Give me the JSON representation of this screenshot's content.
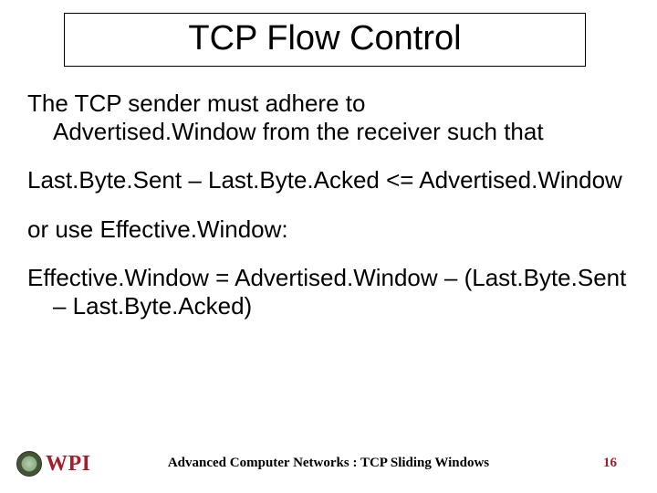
{
  "title": "TCP Flow Control",
  "body": {
    "intro_line1": "The TCP sender must adhere to",
    "intro_line2": "Advertised.Window from the receiver such that",
    "formula1": "Last.Byte.Sent – Last.Byte.Acked <= Advertised.Window",
    "or_use": "or use Effective.Window:",
    "formula2_line1": "Effective.Window = Advertised.Window – (Last.Byte.Sent",
    "formula2_line2": "– Last.Byte.Acked)"
  },
  "footer": {
    "logo_text": "WPI",
    "course": "Advanced Computer Networks : TCP Sliding Windows",
    "page": "16"
  }
}
